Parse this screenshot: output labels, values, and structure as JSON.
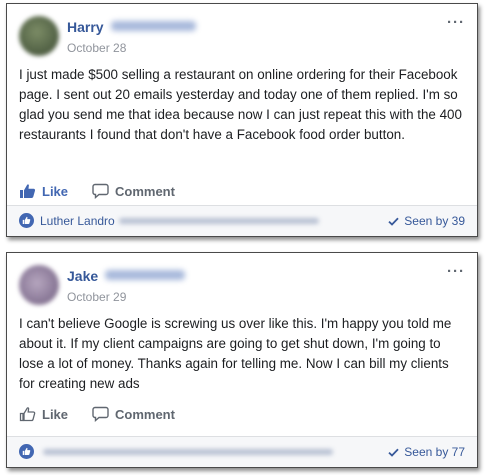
{
  "posts": [
    {
      "author": "Harry",
      "date": "October 28",
      "text": "I just made $500 selling a restaurant on online ordering for their Facebook page. I sent out 20 emails yesterday and today one of them replied. I'm so glad you send me that idea because now I can just repeat this with the 400 restaurants I found that don't have a Facebook food order button.",
      "like_label": "Like",
      "comment_label": "Comment",
      "liked_by": "Luther Landro",
      "seen_by": "Seen by 39",
      "more_label": "···"
    },
    {
      "author": "Jake",
      "date": "October 29",
      "text": "I can't believe Google is screwing us over like this. I'm happy you told me about it. If my client campaigns are going to get shut down, I'm going to lose a lot of money. Thanks again for telling me. Now I can bill my clients for creating new ads",
      "like_label": "Like",
      "comment_label": "Comment",
      "liked_by": "",
      "seen_by": "Seen by 77",
      "more_label": "···"
    }
  ],
  "colors": {
    "link_blue": "#365899",
    "like_active": "#4267b2",
    "muted": "#606770",
    "date_gray": "#90949c"
  },
  "icons": {
    "like": "thumbs-up-icon",
    "comment": "speech-bubble-icon",
    "seen": "checkmark-icon",
    "more": "more-options-icon",
    "like_badge": "like-badge-icon"
  }
}
